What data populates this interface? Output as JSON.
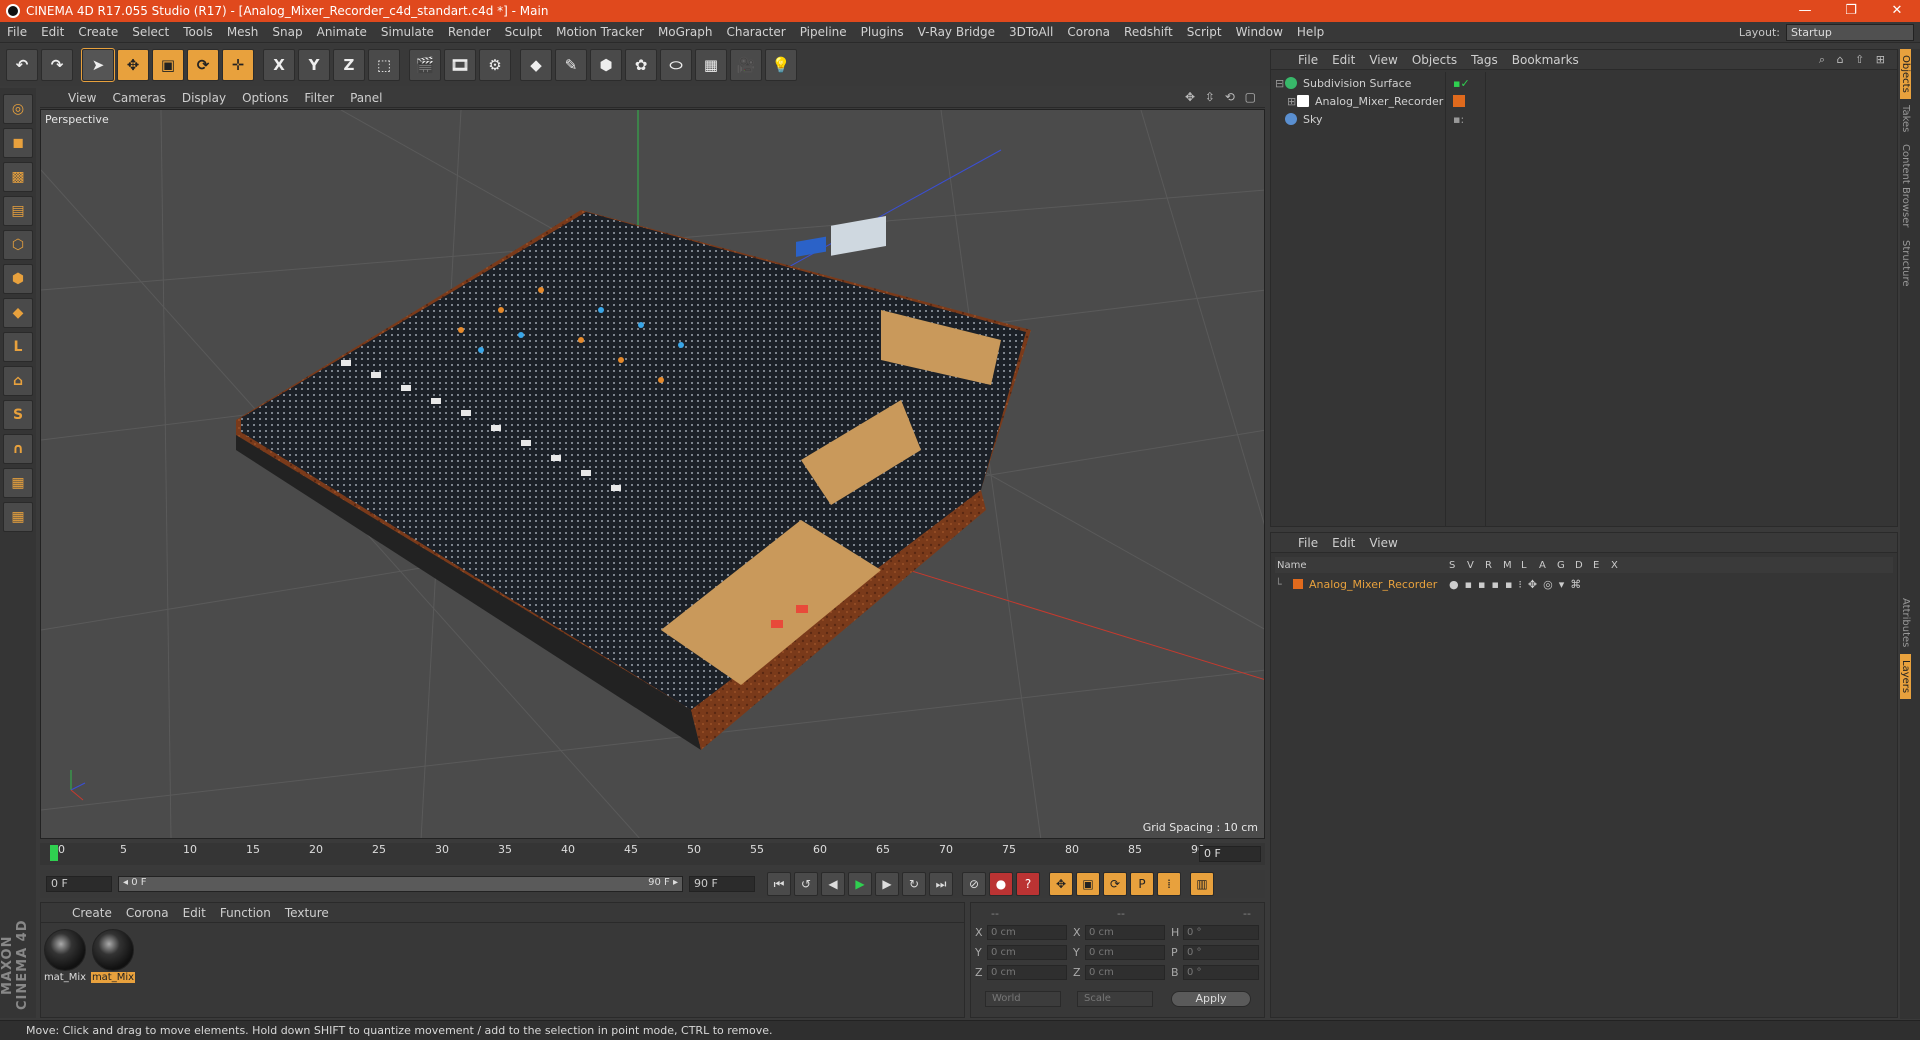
{
  "app": {
    "title": "CINEMA 4D R17.055 Studio (R17) - [Analog_Mixer_Recorder_c4d_standart.c4d *] - Main",
    "window_buttons": [
      "—",
      "❐",
      "✕"
    ]
  },
  "menubar": {
    "items": [
      "File",
      "Edit",
      "Create",
      "Select",
      "Tools",
      "Mesh",
      "Snap",
      "Animate",
      "Simulate",
      "Render",
      "Sculpt",
      "Motion Tracker",
      "MoGraph",
      "Character",
      "Pipeline",
      "Plugins",
      "V-Ray Bridge",
      "3DToAll",
      "Corona",
      "Redshift",
      "Script",
      "Window",
      "Help"
    ],
    "layout_label": "Layout:",
    "layout_value": "Startup"
  },
  "toolbar": {
    "axis_x": "X",
    "axis_y": "Y",
    "axis_z": "Z"
  },
  "viewport": {
    "menu": [
      "View",
      "Cameras",
      "Display",
      "Options",
      "Filter",
      "Panel"
    ],
    "label": "Perspective",
    "grid_spacing": "Grid Spacing : 10 cm",
    "nav_icons": "✥ ⇳ ⟲ ▢"
  },
  "timeline": {
    "ticks": [
      "0",
      "5",
      "10",
      "15",
      "20",
      "25",
      "30",
      "35",
      "40",
      "45",
      "50",
      "55",
      "60",
      "65",
      "70",
      "75",
      "80",
      "85",
      "90"
    ],
    "current_frame": "0 F"
  },
  "transport": {
    "start_frame": "0 F",
    "range_start": "◂ 0 F",
    "range_end": "90 F ▸",
    "end_frame": "90 F"
  },
  "material_manager": {
    "menu": [
      "Create",
      "Corona",
      "Edit",
      "Function",
      "Texture"
    ],
    "materials": [
      {
        "name": "mat_Mix"
      },
      {
        "name": "mat_Mix"
      }
    ]
  },
  "coordinates": {
    "header": [
      "--",
      "--",
      "--"
    ],
    "rows": [
      {
        "a1": "X",
        "v1": "0 cm",
        "a2": "X",
        "v2": "0 cm",
        "a3": "H",
        "v3": "0 °"
      },
      {
        "a1": "Y",
        "v1": "0 cm",
        "a2": "Y",
        "v2": "0 cm",
        "a3": "P",
        "v3": "0 °"
      },
      {
        "a1": "Z",
        "v1": "0 cm",
        "a2": "Z",
        "v2": "0 cm",
        "a3": "B",
        "v3": "0 °"
      }
    ],
    "mode": "World",
    "size_mode": "Scale",
    "apply": "Apply"
  },
  "object_manager": {
    "menu": [
      "File",
      "Edit",
      "View",
      "Objects",
      "Tags",
      "Bookmarks"
    ],
    "objects": [
      {
        "name": "Subdivision Surface",
        "color": "#38b86a"
      },
      {
        "name": "Analog_Mixer_Recorder",
        "color": "#ffffff"
      },
      {
        "name": "Sky",
        "color": "#5a8fd0"
      }
    ]
  },
  "layer_manager": {
    "menu": [
      "File",
      "Edit",
      "View"
    ],
    "columns": [
      "Name",
      "S",
      "V",
      "R",
      "M",
      "L",
      "A",
      "G",
      "D",
      "E",
      "X"
    ],
    "layers": [
      {
        "name": "Analog_Mixer_Recorder",
        "color": "#e06a1d"
      }
    ]
  },
  "right_tabs": [
    "Objects",
    "Takes",
    "Content Browser",
    "Structure",
    "Attributes",
    "Layers"
  ],
  "brand": "MAXON CINEMA 4D",
  "status": "Move: Click and drag to move elements. Hold down SHIFT to quantize movement / add to the selection in point mode, CTRL to remove.",
  "colors": {
    "accent": "#e8a13d",
    "titlebar": "#e0491d"
  }
}
